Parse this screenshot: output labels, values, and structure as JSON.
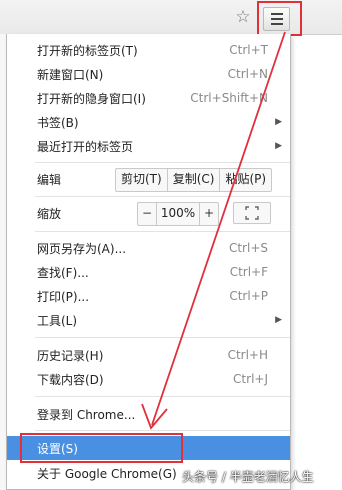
{
  "toolbar": {
    "star_icon": "star-icon",
    "menu_icon": "hamburger-menu-icon"
  },
  "menu": {
    "group1": [
      {
        "label": "打开新的标签页(T)",
        "shortcut": "Ctrl+T"
      },
      {
        "label": "新建窗口(N)",
        "shortcut": "Ctrl+N"
      },
      {
        "label": "打开新的隐身窗口(I)",
        "shortcut": "Ctrl+Shift+N"
      },
      {
        "label": "书签(B)",
        "shortcut": ""
      },
      {
        "label": "最近打开的标签页",
        "shortcut": ""
      }
    ],
    "edit": {
      "label": "编辑",
      "cut": "剪切(T)",
      "copy": "复制(C)",
      "paste": "粘贴(P)"
    },
    "zoom": {
      "label": "缩放",
      "minus": "−",
      "value": "100%",
      "plus": "+"
    },
    "group2": [
      {
        "label": "网页另存为(A)...",
        "shortcut": "Ctrl+S"
      },
      {
        "label": "查找(F)...",
        "shortcut": "Ctrl+F"
      },
      {
        "label": "打印(P)...",
        "shortcut": "Ctrl+P"
      },
      {
        "label": "工具(L)",
        "shortcut": ""
      }
    ],
    "group3": [
      {
        "label": "历史记录(H)",
        "shortcut": "Ctrl+H"
      },
      {
        "label": "下载内容(D)",
        "shortcut": "Ctrl+J"
      }
    ],
    "signin": {
      "label": "登录到 Chrome..."
    },
    "settings": {
      "label": "设置(S)"
    },
    "about": {
      "label": "关于 Google Chrome(G)"
    }
  },
  "watermark": "头条号 / 半壶老酒忆人生",
  "colors": {
    "highlight": "#4a90e2",
    "annotation_red": "#e0303a"
  }
}
